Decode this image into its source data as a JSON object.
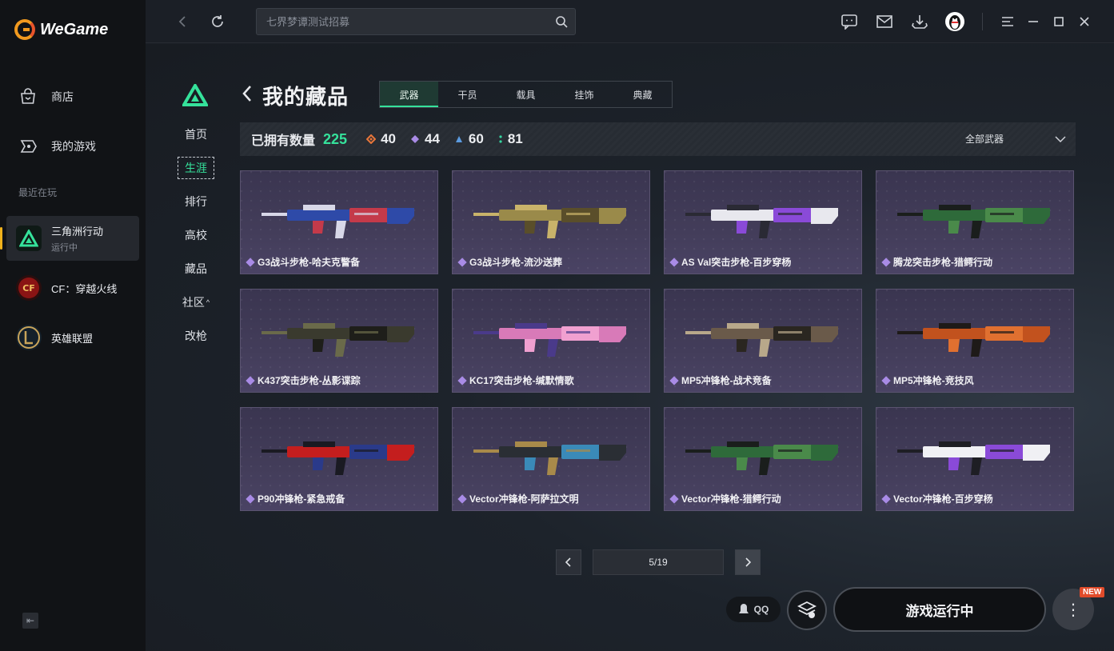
{
  "app": {
    "name": "WeGame"
  },
  "sidebar": {
    "nav": [
      {
        "label": "商店",
        "icon": "shopping-bag-icon"
      },
      {
        "label": "我的游戏",
        "icon": "gamepad-icon"
      }
    ],
    "recent_label": "最近在玩",
    "recent": [
      {
        "name": "三角洲行动",
        "status": "运行中",
        "active": true
      },
      {
        "name": "CF：穿越火线",
        "status": "",
        "active": false
      },
      {
        "name": "英雄联盟",
        "status": "",
        "active": false
      }
    ]
  },
  "topbar": {
    "search_placeholder": "七界梦谭测试招募"
  },
  "subnav": [
    "首页",
    "生涯",
    "排行",
    "高校",
    "藏品",
    "社区",
    "改枪"
  ],
  "page": {
    "title": "我的藏品",
    "tabs": [
      "武器",
      "干员",
      "载具",
      "挂饰",
      "典藏"
    ],
    "active_tab": 0
  },
  "stats": {
    "owned_label": "已拥有数量",
    "total": "225",
    "items": [
      {
        "value": "40",
        "color": "#e8763a"
      },
      {
        "value": "44",
        "color": "#a98be6"
      },
      {
        "value": "60",
        "color": "#5b9be0"
      },
      {
        "value": "81",
        "color": "#35d6a0"
      }
    ],
    "filter_label": "全部武器"
  },
  "weapons": [
    {
      "name": "G3战斗步枪-哈夫克警备",
      "colors": [
        "#2e4aa8",
        "#d8d8e8",
        "#c43a4a"
      ]
    },
    {
      "name": "G3战斗步枪-流沙送葬",
      "colors": [
        "#9a8a4a",
        "#c9b36a",
        "#5a4e2a"
      ]
    },
    {
      "name": "AS Val突击步枪-百步穿杨",
      "colors": [
        "#e8e8ee",
        "#2a2a34",
        "#8a4ad8"
      ]
    },
    {
      "name": "腾龙突击步枪-猎鳄行动",
      "colors": [
        "#2e6a3a",
        "#1a1e1c",
        "#4a8a4a"
      ]
    },
    {
      "name": "K437突击步枪-丛影谍踪",
      "colors": [
        "#3a3a2e",
        "#6a6a4a",
        "#1e1e1a"
      ]
    },
    {
      "name": "KC17突击步枪-缄默情歌",
      "colors": [
        "#d87ab8",
        "#4a3a8a",
        "#f0a0d0"
      ]
    },
    {
      "name": "MP5冲锋枪-战术竞备",
      "colors": [
        "#6a5a4a",
        "#b8a88a",
        "#2a2620"
      ]
    },
    {
      "name": "MP5冲锋枪-竞技风",
      "colors": [
        "#c2521e",
        "#1e1a18",
        "#e07030"
      ]
    },
    {
      "name": "P90冲锋枪-紧急戒备",
      "colors": [
        "#c41e1e",
        "#1a1a22",
        "#2a3a8a"
      ]
    },
    {
      "name": "Vector冲锋枪-阿萨拉文明",
      "colors": [
        "#2a2e34",
        "#a88a4a",
        "#3a8ab8"
      ]
    },
    {
      "name": "Vector冲锋枪-猎鳄行动",
      "colors": [
        "#2e6a3a",
        "#1a1e1c",
        "#4a8a4a"
      ]
    },
    {
      "name": "Vector冲锋枪-百步穿杨",
      "colors": [
        "#f0f0f4",
        "#1e1e24",
        "#8a4ad8"
      ]
    }
  ],
  "pagination": {
    "label": "5/19"
  },
  "bottom": {
    "qq_label": "QQ",
    "run_label": "游戏运行中",
    "new_badge": "NEW"
  }
}
